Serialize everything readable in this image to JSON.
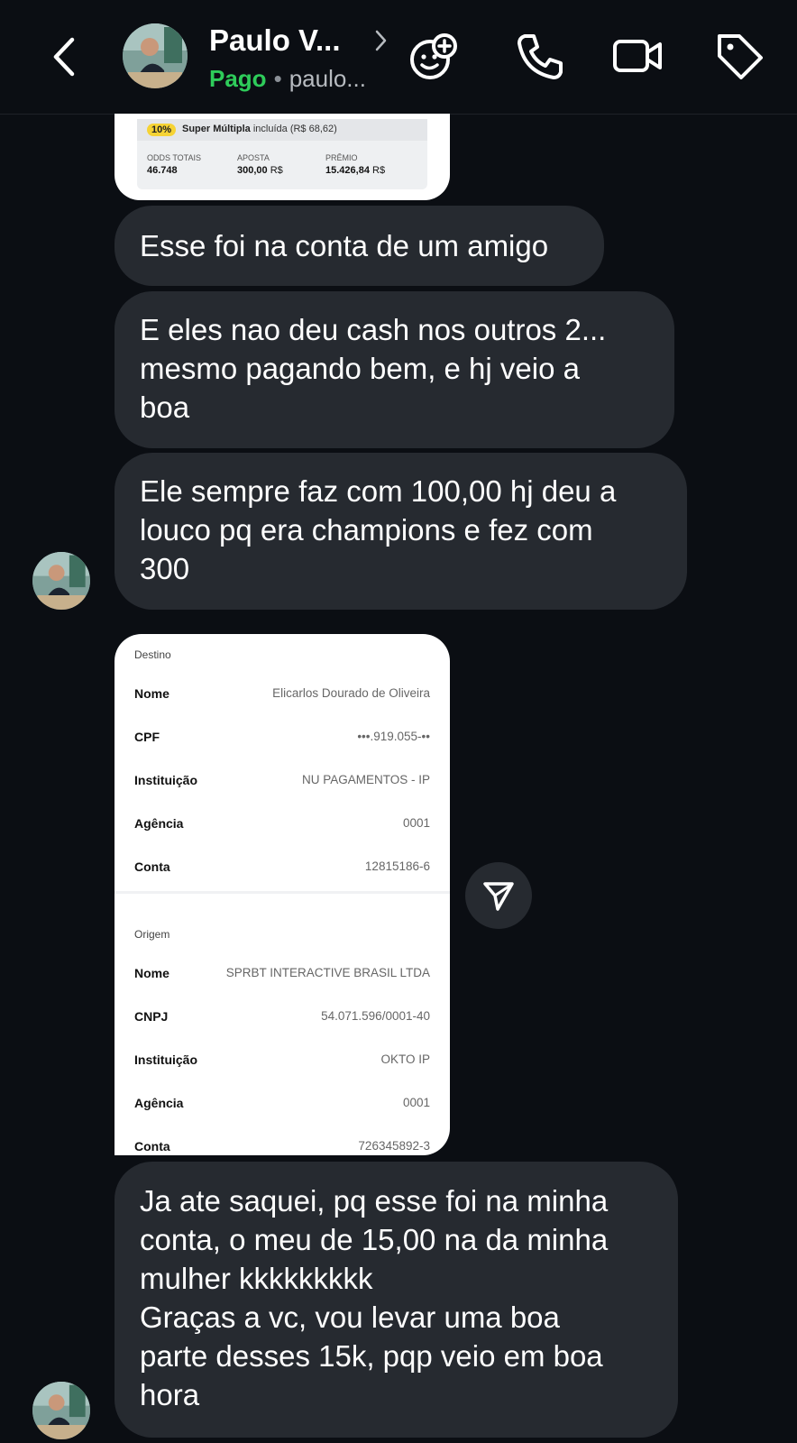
{
  "header": {
    "name": "Paulo V...",
    "status": "Pago",
    "separator": "•",
    "username": "paulo...",
    "icons": {
      "back": "chevron-left-icon",
      "profile": "chevron-right-icon",
      "effects": "add-effect-icon",
      "call": "phone-icon",
      "video": "video-icon",
      "tag": "tag-icon"
    }
  },
  "bet_card": {
    "boost_pct": "10%",
    "boost_label": "Super Múltipla",
    "boost_suffix": "incluída (R$ 68,62)",
    "odds_label": "ODDS TOTAIS",
    "odds_value": "46.748",
    "stake_label": "APOSTA",
    "stake_value": "300,00",
    "stake_currency": "R$",
    "prize_label": "PRÊMIO",
    "prize_value": "15.426,84",
    "prize_currency": "R$"
  },
  "messages": [
    {
      "text": "Esse foi na conta de um amigo"
    },
    {
      "text": "E eles nao deu cash nos outros 2...\nmesmo pagando bem, e hj veio a\nboa"
    },
    {
      "text": "Ele sempre faz com 100,00 hj deu a\nlouco pq era champions e fez com\n300"
    },
    {
      "text": "Ja ate saquei, pq esse foi na minha\nconta, o meu de 15,00 na da minha\nmulher kkkkkkkkk\nGraças a vc, vou levar uma boa\nparte desses 15k, pqp veio em boa\nhora"
    }
  ],
  "receipt": {
    "destino": {
      "title": "Destino",
      "rows": [
        {
          "k": "Nome",
          "v": "Elicarlos Dourado de Oliveira"
        },
        {
          "k": "CPF",
          "v": "•••.919.055-••"
        },
        {
          "k": "Instituição",
          "v": "NU PAGAMENTOS - IP"
        },
        {
          "k": "Agência",
          "v": "0001"
        },
        {
          "k": "Conta",
          "v": "12815186-6"
        }
      ]
    },
    "origem": {
      "title": "Origem",
      "rows": [
        {
          "k": "Nome",
          "v": "SPRBT INTERACTIVE BRASIL LTDA"
        },
        {
          "k": "CNPJ",
          "v": "54.071.596/0001-40"
        },
        {
          "k": "Instituição",
          "v": "OKTO IP"
        },
        {
          "k": "Agência",
          "v": "0001"
        },
        {
          "k": "Conta",
          "v": "726345892-3"
        }
      ]
    }
  },
  "colors": {
    "background": "#0b0e13",
    "bubble": "#262a30",
    "status_green": "#2ecc5a",
    "boost_yellow": "#f6d334"
  }
}
